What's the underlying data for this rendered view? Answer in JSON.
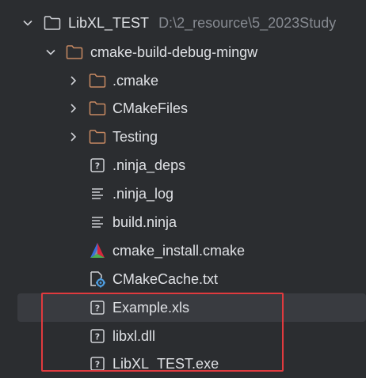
{
  "tree": {
    "root": {
      "label": "LibXL_TEST",
      "path_hint": "D:\\2_resource\\5_2023Study",
      "icon": "folder-icon",
      "expanded": true
    },
    "build_dir": {
      "label": "cmake-build-debug-mingw",
      "icon": "folder-icon",
      "expanded": true
    },
    "items": [
      {
        "label": ".cmake",
        "icon": "folder-icon",
        "kind": "folder"
      },
      {
        "label": "CMakeFiles",
        "icon": "folder-icon",
        "kind": "folder"
      },
      {
        "label": "Testing",
        "icon": "folder-icon",
        "kind": "folder"
      },
      {
        "label": ".ninja_deps",
        "icon": "unknown-file-icon",
        "kind": "file"
      },
      {
        "label": ".ninja_log",
        "icon": "text-file-icon",
        "kind": "file"
      },
      {
        "label": "build.ninja",
        "icon": "text-file-icon",
        "kind": "file"
      },
      {
        "label": "cmake_install.cmake",
        "icon": "cmake-icon",
        "kind": "file"
      },
      {
        "label": "CMakeCache.txt",
        "icon": "settings-file-icon",
        "kind": "file"
      },
      {
        "label": "Example.xls",
        "icon": "unknown-file-icon",
        "kind": "file",
        "selected": true
      },
      {
        "label": "libxl.dll",
        "icon": "unknown-file-icon",
        "kind": "file"
      },
      {
        "label": "LibXL_TEST.exe",
        "icon": "unknown-file-icon",
        "kind": "file"
      }
    ]
  },
  "colors": {
    "background": "#2b2d30",
    "text": "#dfe1e5",
    "muted_text": "#868a91",
    "folder_stroke": "#c88a62",
    "selection": "#393b40",
    "highlight": "#e03a3e"
  }
}
